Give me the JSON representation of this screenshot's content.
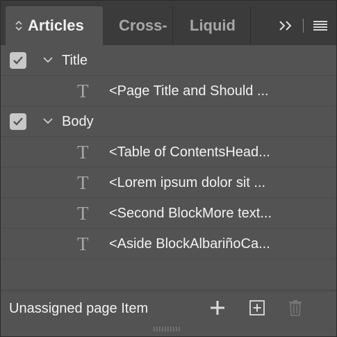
{
  "tabs": [
    {
      "label": "Articles",
      "active": true
    },
    {
      "label": "Cross-",
      "active": false
    },
    {
      "label": "Liquid",
      "active": false
    }
  ],
  "tabbar_icons": {
    "overflow": "double-chevron-right-icon",
    "menu": "hamburger-menu-icon",
    "sort": "up-down-icon"
  },
  "articles": [
    {
      "name": "Title",
      "checked": true,
      "expanded": true,
      "items": [
        {
          "type_icon": "T",
          "label": "<Page Title and Should ..."
        }
      ]
    },
    {
      "name": "Body",
      "checked": true,
      "expanded": true,
      "items": [
        {
          "type_icon": "T",
          "label": "<Table of ContentsHead..."
        },
        {
          "type_icon": "T",
          "label": "<Lorem ipsum dolor sit ..."
        },
        {
          "type_icon": "T",
          "label": "<Second BlockMore text..."
        },
        {
          "type_icon": "T",
          "label": "<Aside BlockAlbariñoCa..."
        }
      ]
    }
  ],
  "footer": {
    "label": "Unassigned page Item",
    "buttons": [
      "plus-icon",
      "add-selected-icon",
      "trash-icon"
    ]
  },
  "colors": {
    "panel": "#535353",
    "tabbar": "#3b3b3b",
    "text": "#f2f2f2",
    "muted": "#a8a8a8"
  }
}
